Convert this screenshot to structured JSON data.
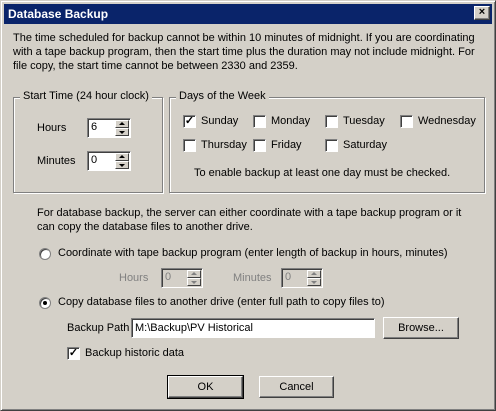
{
  "window": {
    "title": "Database Backup",
    "close_glyph": "×"
  },
  "intro_text": "The time scheduled for backup cannot be within 10 minutes of midnight. If you are coordinating with a tape backup program, then the start time plus the duration may not include midnight. For file copy, the start time cannot be between 2330 and 2359.",
  "start_time": {
    "group_label": "Start Time (24 hour clock)",
    "hours_label": "Hours",
    "hours_value": "6",
    "minutes_label": "Minutes",
    "minutes_value": "0"
  },
  "days": {
    "group_label": "Days of the Week",
    "items": [
      {
        "label": "Sunday",
        "checked": true
      },
      {
        "label": "Monday",
        "checked": false
      },
      {
        "label": "Tuesday",
        "checked": false
      },
      {
        "label": "Wednesday",
        "checked": false
      },
      {
        "label": "Thursday",
        "checked": false
      },
      {
        "label": "Friday",
        "checked": false
      },
      {
        "label": "Saturday",
        "checked": false
      }
    ],
    "note": "To enable backup at least one day must be checked."
  },
  "backup_desc": "For database backup, the server can either coordinate with a tape backup program or it can copy the database files to another drive.",
  "tape_option": {
    "label": "Coordinate with tape backup program (enter length of backup in hours, minutes)",
    "selected": false,
    "hours_label": "Hours",
    "hours_value": "0",
    "minutes_label": "Minutes",
    "minutes_value": "0"
  },
  "copy_option": {
    "label": "Copy database files to another drive (enter full path to copy files to)",
    "selected": true,
    "path_label": "Backup Path",
    "path_value": "M:\\Backup\\PV Historical",
    "browse_label": "Browse..."
  },
  "historic": {
    "label": "Backup historic data",
    "checked": true
  },
  "buttons": {
    "ok": "OK",
    "cancel": "Cancel"
  },
  "colors": {
    "titlebar": "#0a246a",
    "face": "#d4d0c8"
  }
}
